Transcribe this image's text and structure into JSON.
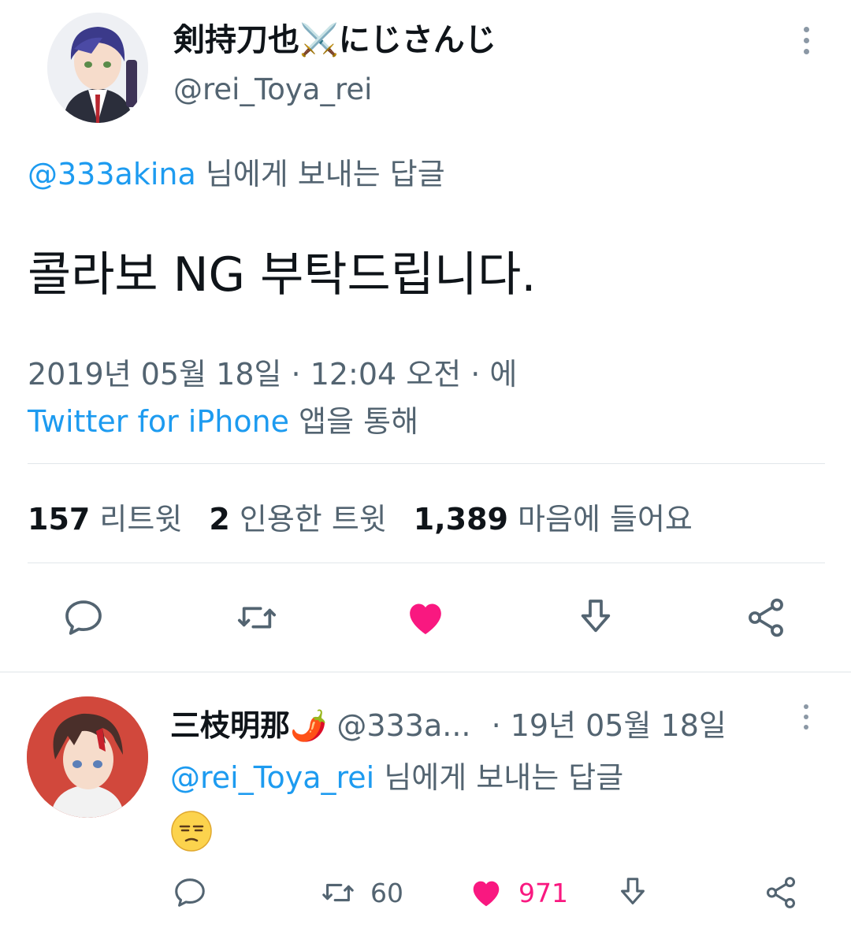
{
  "main_tweet": {
    "display_name": "剣持刀也⚔️にじさんじ",
    "handle": "@rei_Toya_rei",
    "reply_to_handle": "@333akina",
    "reply_to_suffix": " 님에게 보내는 답글",
    "text": "콜라보 NG 부탁드립니다.",
    "timestamp": "2019년 05월 18일 · 12:04 오전 · 에",
    "source_app": "Twitter for iPhone",
    "source_suffix": " 앱을 통해",
    "stats": [
      {
        "count": "157",
        "label": "리트윗"
      },
      {
        "count": "2",
        "label": "인용한 트윗"
      },
      {
        "count": "1,389",
        "label": "마음에 들어요"
      }
    ],
    "actions": [
      "reply-icon",
      "retweet-icon",
      "like-icon",
      "download-icon",
      "share-icon"
    ]
  },
  "reply_tweet": {
    "display_name": "三枝明那🌶️",
    "handle": "@333a...",
    "date": "· 19년 05월 18일",
    "reply_to_handle": "@rei_Toya_rei",
    "reply_to_suffix": " 님에게 보내는 답글",
    "text": "😒",
    "retweet_count": "60",
    "like_count": "971"
  },
  "colors": {
    "link": "#1d9bf0",
    "like": "#f91880",
    "muted": "#536471",
    "text": "#0f1419"
  }
}
